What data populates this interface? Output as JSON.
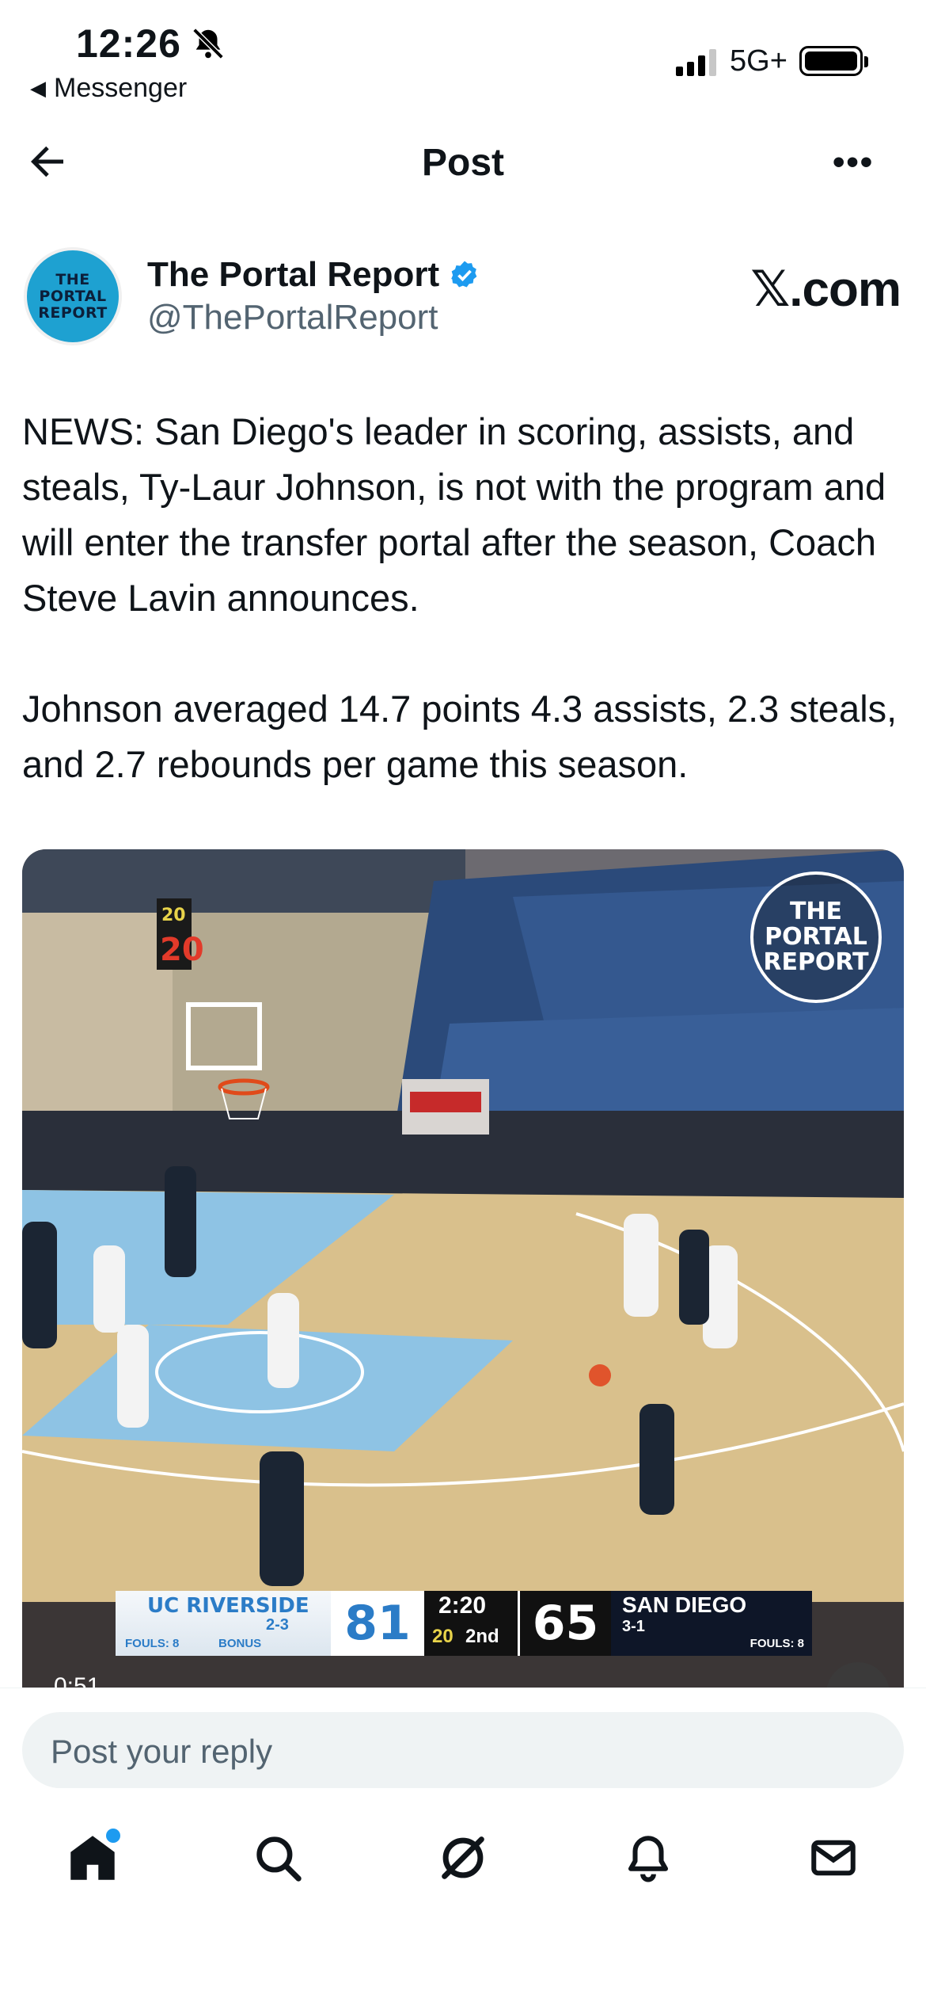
{
  "status_bar": {
    "time": "12:26",
    "back_app": "Messenger",
    "network": "5G+",
    "icons": [
      "bell-slash-icon",
      "signal-icon",
      "battery-icon"
    ]
  },
  "header": {
    "title": "Post",
    "more": "•••",
    "icons": [
      "back-arrow-icon",
      "more-icon"
    ]
  },
  "author": {
    "avatar_text": [
      "THE",
      "PORTAL",
      "REPORT"
    ],
    "name": "The Portal Report",
    "handle": "@ThePortalReport",
    "source": "𝕏.com",
    "verified_color": "#1d9bf0"
  },
  "post": {
    "paragraphs": [
      "NEWS: San Diego's leader in scoring, assists, and steals, Ty-Laur Johnson, is not with the program and will enter the transfer portal after the season, Coach Steve Lavin announces.",
      "Johnson averaged 14.7 points 4.3 assists, 2.3 steals, and 2.7 rebounds per game this season."
    ]
  },
  "media": {
    "watermark": [
      "THE",
      "PORTAL",
      "REPORT"
    ],
    "duration": "0:51",
    "shot_clock": "20",
    "scoreboard": {
      "team1": "UC RIVERSIDE",
      "team1_record": "2-3",
      "team1_fouls": "FOULS: 8",
      "team1_bonus": "BONUS",
      "team1_score": "81",
      "clock": "2:20",
      "shot": "20",
      "period": "2nd",
      "team2_score": "65",
      "team2": "SAN DIEGO",
      "team2_record": "3-1",
      "team2_fouls": "FOULS: 8"
    }
  },
  "reply": {
    "placeholder": "Post your reply"
  },
  "tabbar": {
    "items": [
      "home-icon",
      "search-icon",
      "grok-icon",
      "notifications-icon",
      "messages-icon"
    ],
    "accent": "#1d9bf0"
  }
}
